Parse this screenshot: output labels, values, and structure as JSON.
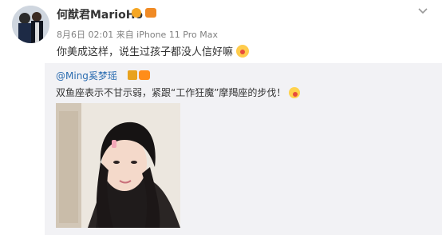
{
  "post": {
    "author": "何猷君MarioHo",
    "meta": "8月6日 02:01 来自 iPhone 11 Pro Max",
    "text": "你美成这样，说生过孩子都没人信好嘛",
    "emoji": "kiss-emoji"
  },
  "repost": {
    "user": "@Ming奚梦瑶",
    "text": "双鱼座表示不甘示弱，紧跟“工作狂魔”摩羯座的步伐！",
    "emoji": "smile-emoji"
  },
  "icons": {
    "chevron": "chevron-down-icon",
    "verified": "verified-badge-icon"
  },
  "colors": {
    "link": "#2b6cb0",
    "meta": "#808080",
    "repost_bg": "#f2f2f5"
  }
}
